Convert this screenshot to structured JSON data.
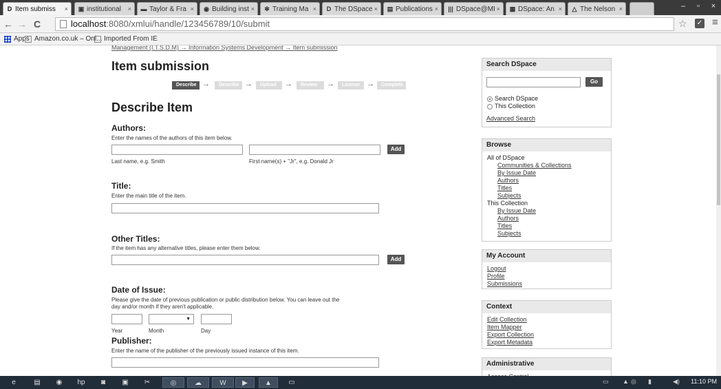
{
  "browser": {
    "tabs": [
      {
        "icon": "D",
        "title": "Item submiss",
        "close": "×"
      },
      {
        "icon": "▣",
        "title": "institutional",
        "close": "×"
      },
      {
        "icon": "▬",
        "title": "Taylor & Fra",
        "close": "×"
      },
      {
        "icon": "◉",
        "title": "Building insti",
        "close": "×"
      },
      {
        "icon": "✻",
        "title": "Training Ma",
        "close": "×"
      },
      {
        "icon": "D",
        "title": "The DSpace",
        "close": "×"
      },
      {
        "icon": "▤",
        "title": "Publications",
        "close": "×"
      },
      {
        "icon": "|||",
        "title": "DSpace@MI",
        "close": "×"
      },
      {
        "icon": "▦",
        "title": "DSpace: An I",
        "close": "×"
      },
      {
        "icon": "△",
        "title": "The Nelson I",
        "close": "×"
      }
    ],
    "window_controls": [
      "–",
      "▫",
      "×"
    ],
    "nav": {
      "back": "←",
      "forward": "→",
      "reload": "C"
    },
    "url_host": "localhost",
    "url_path": ":8080/xmlui/handle/123456789/10/submit",
    "star": "☆",
    "menu": "≡",
    "bookmarks": [
      "Apps",
      "Amazon.co.uk – Onl...",
      "Imported From IE"
    ]
  },
  "page": {
    "breadcrumb": "Management (I.T.S.D.M)  →  Information Systems Development  →  Item submission",
    "title": "Item submission",
    "steps": [
      "Describe",
      "Describe",
      "Upload",
      "Review",
      "License",
      "Complete"
    ],
    "arrow": "→",
    "section_title": "Describe Item",
    "authors": {
      "label": "Authors:",
      "hint": "Enter the names of the authors of this item below.",
      "last_name_sub": "Last name, e.g. Smith",
      "first_name_sub": "First name(s) + \"Jr\", e.g. Donald Jr",
      "add": "Add"
    },
    "title_field": {
      "label": "Title:",
      "hint": "Enter the main title of the item."
    },
    "other_titles": {
      "label": "Other Titles:",
      "hint": "If the item has any alternative titles, please enter them below.",
      "add": "Add"
    },
    "date_of_issue": {
      "label": "Date of Issue:",
      "hint1": "Please give the date of previous publication or public distribution below. You can leave out the",
      "hint2": "day and/or month if they aren't applicable.",
      "month_arrow": "▼",
      "year": "Year",
      "month": "Month",
      "day": "Day"
    },
    "publisher": {
      "label": "Publisher:",
      "hint": "Enter the name of the publisher of the previously issued instance of this item."
    }
  },
  "sidebar": {
    "search": {
      "title": "Search DSpace",
      "go": "Go",
      "options": [
        "Search DSpace",
        "This Collection"
      ],
      "selected": 0,
      "advanced": "Advanced Search"
    },
    "browse": {
      "title": "Browse",
      "all_label": "All of DSpace",
      "all_links": [
        "Communities & Collections",
        "By Issue Date",
        "Authors",
        "Titles",
        "Subjects"
      ],
      "coll_label": "This Collection",
      "coll_links": [
        "By Issue Date",
        "Authors",
        "Titles",
        "Subjects"
      ]
    },
    "account": {
      "title": "My Account",
      "links": [
        "Logout",
        "Profile",
        "Submissions"
      ]
    },
    "context": {
      "title": "Context",
      "links": [
        "Edit Collection",
        "Item Mapper",
        "Export Collection",
        "Export Metadata"
      ]
    },
    "admin": {
      "title": "Administrative",
      "links": [
        "Access Control"
      ]
    }
  },
  "taskbar": {
    "clock": "11:10 PM",
    "apps": [
      "e",
      "▤",
      "◉",
      "hp",
      "◙",
      "▣",
      "✂",
      "◎",
      "☁",
      "W",
      "▶",
      "▲",
      "▭"
    ]
  }
}
